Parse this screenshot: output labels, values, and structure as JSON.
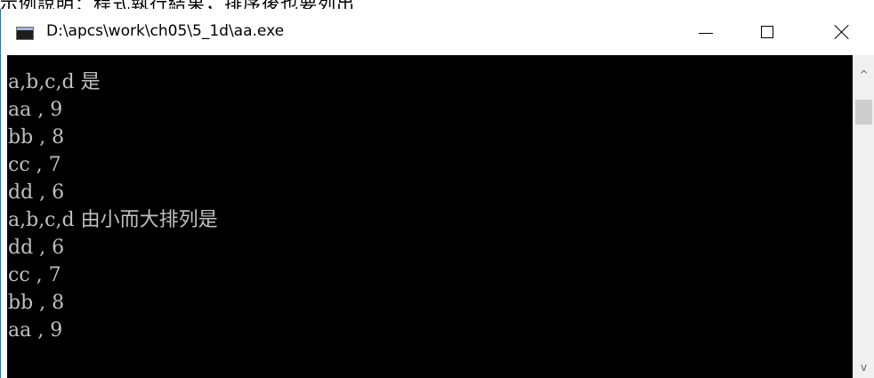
{
  "background_snippet": "示例說明：程式執行結果，排序後也要列出",
  "window": {
    "title": "D:\\apcs\\work\\ch05\\5_1d\\aa.exe",
    "icon": "console-app-icon"
  },
  "console": {
    "lines": [
      "a,b,c,d 是",
      "aa , 9",
      "bb , 8",
      "cc , 7",
      "dd , 6",
      "a,b,c,d 由小而大排列是",
      "dd , 6",
      "cc , 7",
      "bb , 8",
      "aa , 9"
    ],
    "text_color": "#c0c0c0",
    "background_color": "#000000"
  },
  "caption_buttons": {
    "minimize_icon": "minimize-icon",
    "maximize_icon": "maximize-icon",
    "close_icon": "close-icon"
  },
  "scrollbar": {
    "up_arrow": "^",
    "down_arrow": "v"
  }
}
